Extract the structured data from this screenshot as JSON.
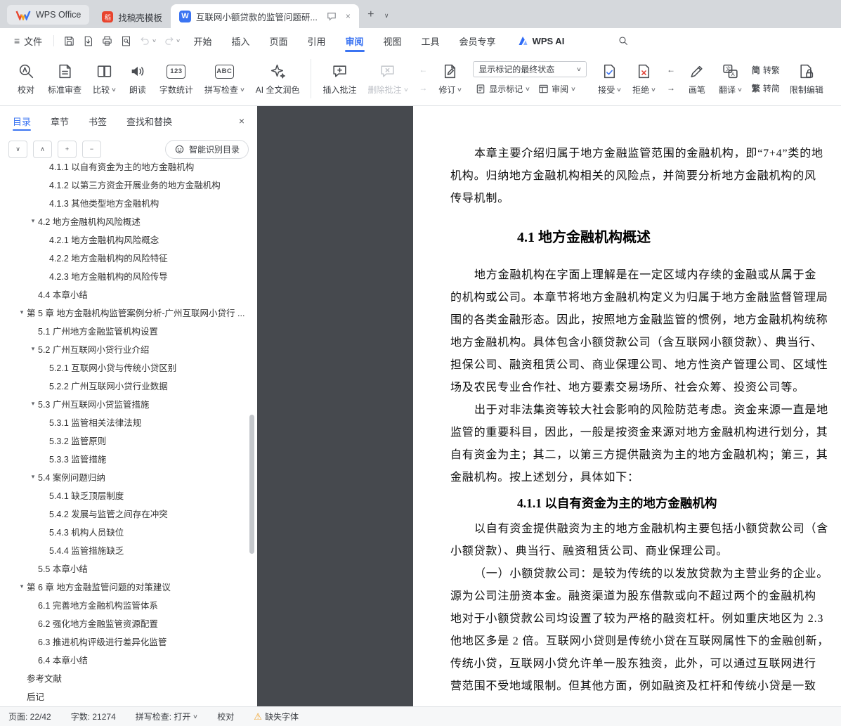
{
  "icons": {
    "chevron_down": "∨",
    "chevron_up": "∧",
    "expander": "▾",
    "plus": "+",
    "minus": "−",
    "close": "×",
    "hamburger": "≡",
    "warning": "⚠",
    "prev": "←",
    "next": "→"
  },
  "tabbar": {
    "tabs": [
      {
        "label": "WPS Office"
      },
      {
        "label": "找稿壳模板"
      },
      {
        "label": "互联网小额贷款的监管问题研..."
      }
    ]
  },
  "menubar": {
    "file": "文件",
    "items": [
      "开始",
      "插入",
      "页面",
      "引用",
      "审阅",
      "视图",
      "工具",
      "会员专享"
    ],
    "active_item": "审阅",
    "wps_ai": "WPS AI"
  },
  "ribbon": {
    "proofread": "校对",
    "standard_review": "标准审查",
    "compare": "比较",
    "read_aloud": "朗读",
    "word_count": "字数统计",
    "word_count_glyph": "123",
    "spell_check": "拼写检查",
    "spell_glyph": "ABC",
    "ai_polish": "AI 全文润色",
    "insert_comment": "插入批注",
    "delete_comment": "删除批注",
    "revise": "修订",
    "markup_state": "显示标记的最终状态",
    "show_markup": "显示标记",
    "review_pane": "审阅",
    "accept": "接受",
    "reject": "拒绝",
    "pen": "画笔",
    "translate": "翻译",
    "simp_glyph": "简",
    "trad_glyph": "繁",
    "to_traditional": "转繁",
    "to_simplified": "转简",
    "restrict_edit": "限制编辑"
  },
  "sidebar": {
    "tabs": [
      "目录",
      "章节",
      "书签",
      "查找和替换"
    ],
    "active_tab": "目录",
    "smart_toc_button": "智能识别目录",
    "toc": [
      {
        "text": "4.1.1 以自有资金为主的地方金融机构",
        "level": 3,
        "expander": false,
        "cut": true
      },
      {
        "text": "4.1.2 以第三方资金开展业务的地方金融机构",
        "level": 3,
        "expander": false
      },
      {
        "text": "4.1.3 其他类型地方金融机构",
        "level": 3,
        "expander": false
      },
      {
        "text": "4.2 地方金融机构风险概述",
        "level": 2,
        "expander": true
      },
      {
        "text": "4.2.1 地方金融机构风险概念",
        "level": 3,
        "expander": false
      },
      {
        "text": "4.2.2 地方金融机构的风险特征",
        "level": 3,
        "expander": false
      },
      {
        "text": "4.2.3 地方金融机构的风险传导",
        "level": 3,
        "expander": false
      },
      {
        "text": "4.4 本章小结",
        "level": 2,
        "expander": false
      },
      {
        "text": "第 5 章 地方金融机构监管案例分析-广州互联网小贷行 ...",
        "level": 1,
        "expander": true
      },
      {
        "text": "5.1 广州地方金融监管机构设置",
        "level": 2,
        "expander": false
      },
      {
        "text": "5.2 广州互联网小贷行业介绍",
        "level": 2,
        "expander": true
      },
      {
        "text": "5.2.1 互联网小贷与传统小贷区别",
        "level": 3,
        "expander": false
      },
      {
        "text": "5.2.2 广州互联网小贷行业数据",
        "level": 3,
        "expander": false
      },
      {
        "text": "5.3 广州互联网小贷监管措施",
        "level": 2,
        "expander": true
      },
      {
        "text": "5.3.1 监管相关法律法规",
        "level": 3,
        "expander": false
      },
      {
        "text": "5.3.2 监管原则",
        "level": 3,
        "expander": false
      },
      {
        "text": "5.3.3 监管措施",
        "level": 3,
        "expander": false
      },
      {
        "text": "5.4 案例问题归纳",
        "level": 2,
        "expander": true
      },
      {
        "text": "5.4.1 缺乏顶层制度",
        "level": 3,
        "expander": false
      },
      {
        "text": "5.4.2 发展与监管之间存在冲突",
        "level": 3,
        "expander": false
      },
      {
        "text": "5.4.3 机构人员缺位",
        "level": 3,
        "expander": false
      },
      {
        "text": "5.4.4 监管措施缺乏",
        "level": 3,
        "expander": false
      },
      {
        "text": "5.5 本章小结",
        "level": 2,
        "expander": false
      },
      {
        "text": "第 6 章 地方金融监管问题的对策建议",
        "level": 1,
        "expander": true
      },
      {
        "text": "6.1 完善地方金融机构监管体系",
        "level": 2,
        "expander": false
      },
      {
        "text": "6.2 强化地方金融监管资源配置",
        "level": 2,
        "expander": false
      },
      {
        "text": "6.3 推进机构评级进行差异化监管",
        "level": 2,
        "expander": false
      },
      {
        "text": "6.4 本章小结",
        "level": 2,
        "expander": false
      },
      {
        "text": "参考文献",
        "level": 1,
        "expander": false
      },
      {
        "text": "后记",
        "level": 1,
        "expander": false
      }
    ]
  },
  "document": {
    "blocks": [
      {
        "type": "para",
        "lines": [
          "本章主要介绍归属于地方金融监管范围的金融机构，即“7+4”类的地",
          "机构。归纳地方金融机构相关的风险点，并简要分析地方金融机构的风",
          "传导机制。"
        ]
      },
      {
        "type": "h1",
        "text": "4.1 地方金融机构概述"
      },
      {
        "type": "para",
        "lines": [
          "地方金融机构在字面上理解是在一定区域内存续的金融或从属于金",
          "的机构或公司。本章节将地方金融机构定义为归属于地方金融监督管理局",
          "围的各类金融形态。因此，按照地方金融监管的惯例，地方金融机构统称",
          "地方金融机构。具体包含小额贷款公司（含互联网小额贷款）、典当行、",
          "担保公司、融资租赁公司、商业保理公司、地方性资产管理公司、区域性",
          "场及农民专业合作社、地方要素交易场所、社会众筹、投资公司等。"
        ]
      },
      {
        "type": "para",
        "lines": [
          "出于对非法集资等较大社会影响的风险防范考虑。资金来源一直是地",
          "监管的重要科目，因此，一般是按资金来源对地方金融机构进行划分，其",
          "自有资金为主；其二，以第三方提供融资为主的地方金融机构；第三，其",
          "金融机构。按上述划分，具体如下："
        ]
      },
      {
        "type": "h2",
        "text": "4.1.1 以自有资金为主的地方金融机构"
      },
      {
        "type": "para",
        "lines": [
          "以自有资金提供融资为主的地方金融机构主要包括小额贷款公司（含",
          "小额贷款）、典当行、融资租赁公司、商业保理公司。"
        ]
      },
      {
        "type": "para",
        "lines": [
          "（一）小额贷款公司：是较为传统的以发放贷款为主营业务的企业。",
          "源为公司注册资本金。融资渠道为股东借款或向不超过两个的金融机构",
          "地对于小额贷款公司均设置了较为严格的融资杠杆。例如重庆地区为 2.3",
          "他地区多是 2 倍。互联网小贷则是传统小贷在互联网属性下的金融创新，",
          "传统小贷，互联网小贷允许单一股东独资，此外，可以通过互联网进行",
          "营范围不受地域限制。但其他方面，例如融资及杠杆和传统小贷是一致"
        ]
      }
    ]
  },
  "statusbar": {
    "page": "页面: 22/42",
    "words": "字数: 21274",
    "spellcheck": "拼写检查: 打开",
    "proofread": "校对",
    "missing_font": "缺失字体"
  },
  "colors": {
    "accent": "#3b74f2",
    "warning": "#f0a32c",
    "canvas": "#46494e"
  }
}
